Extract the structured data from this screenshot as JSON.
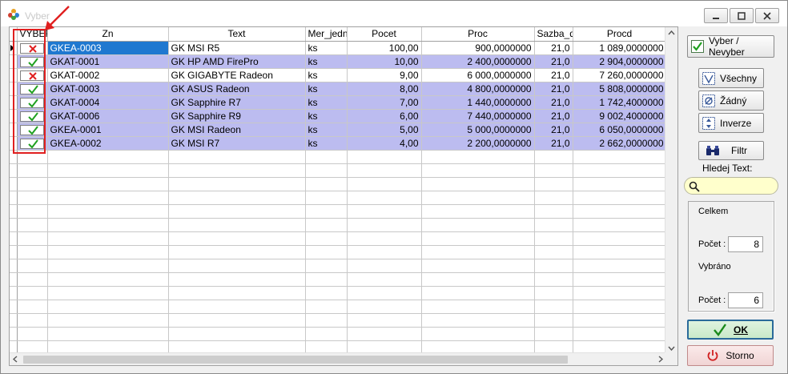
{
  "window": {
    "title": "Vyber"
  },
  "columns": [
    "VYBER",
    "Zn",
    "Text",
    "Mer_jedn",
    "Pocet",
    "Proc",
    "Sazba_d",
    "Procd"
  ],
  "rows": [
    {
      "selected": false,
      "zn": "GKEA-0003",
      "text": "GK MSI R5",
      "mj": "ks",
      "pocet": "100,00",
      "proc": "900,0000000",
      "sazba": "21,0",
      "procd": "1 089,0000000"
    },
    {
      "selected": true,
      "zn": "GKAT-0001",
      "text": "GK HP AMD FirePro",
      "mj": "ks",
      "pocet": "10,00",
      "proc": "2 400,0000000",
      "sazba": "21,0",
      "procd": "2 904,0000000"
    },
    {
      "selected": false,
      "zn": "GKAT-0002",
      "text": "GK  GIGABYTE Radeon",
      "mj": "ks",
      "pocet": "9,00",
      "proc": "6 000,0000000",
      "sazba": "21,0",
      "procd": "7 260,0000000"
    },
    {
      "selected": true,
      "zn": "GKAT-0003",
      "text": "GK ASUS Radeon",
      "mj": "ks",
      "pocet": "8,00",
      "proc": "4 800,0000000",
      "sazba": "21,0",
      "procd": "5 808,0000000"
    },
    {
      "selected": true,
      "zn": "GKAT-0004",
      "text": "GK Sapphire R7",
      "mj": "ks",
      "pocet": "7,00",
      "proc": "1 440,0000000",
      "sazba": "21,0",
      "procd": "1 742,4000000"
    },
    {
      "selected": true,
      "zn": "GKAT-0006",
      "text": "GK Sapphire R9",
      "mj": "ks",
      "pocet": "6,00",
      "proc": "7 440,0000000",
      "sazba": "21,0",
      "procd": "9 002,4000000"
    },
    {
      "selected": true,
      "zn": "GKEA-0001",
      "text": "GK MSI  Radeon",
      "mj": "ks",
      "pocet": "5,00",
      "proc": "5 000,0000000",
      "sazba": "21,0",
      "procd": "6 050,0000000"
    },
    {
      "selected": true,
      "zn": "GKEA-0002",
      "text": "GK MSI R7",
      "mj": "ks",
      "pocet": "4,00",
      "proc": "2 200,0000000",
      "sazba": "21,0",
      "procd": "2 662,0000000"
    }
  ],
  "panel": {
    "toggle_label": "Vyber / Nevyber",
    "all_label": "Všechny",
    "none_label": "Žádný",
    "invert_label": "Inverze",
    "filter_label": "Filtr",
    "search_label": "Hledej Text:",
    "search_value": "",
    "total_heading": "Celkem",
    "total_count_label": "Počet :",
    "total_count": "8",
    "selected_heading": "Vybráno",
    "selected_count_label": "Počet :",
    "selected_count": "6",
    "ok_label": "OK",
    "cancel_label": "Storno"
  },
  "colors": {
    "selected_row": "#bcbcf0",
    "current_cell": "#1f78d0",
    "annotation": "#e02020",
    "search_bg": "#ffffcc"
  }
}
